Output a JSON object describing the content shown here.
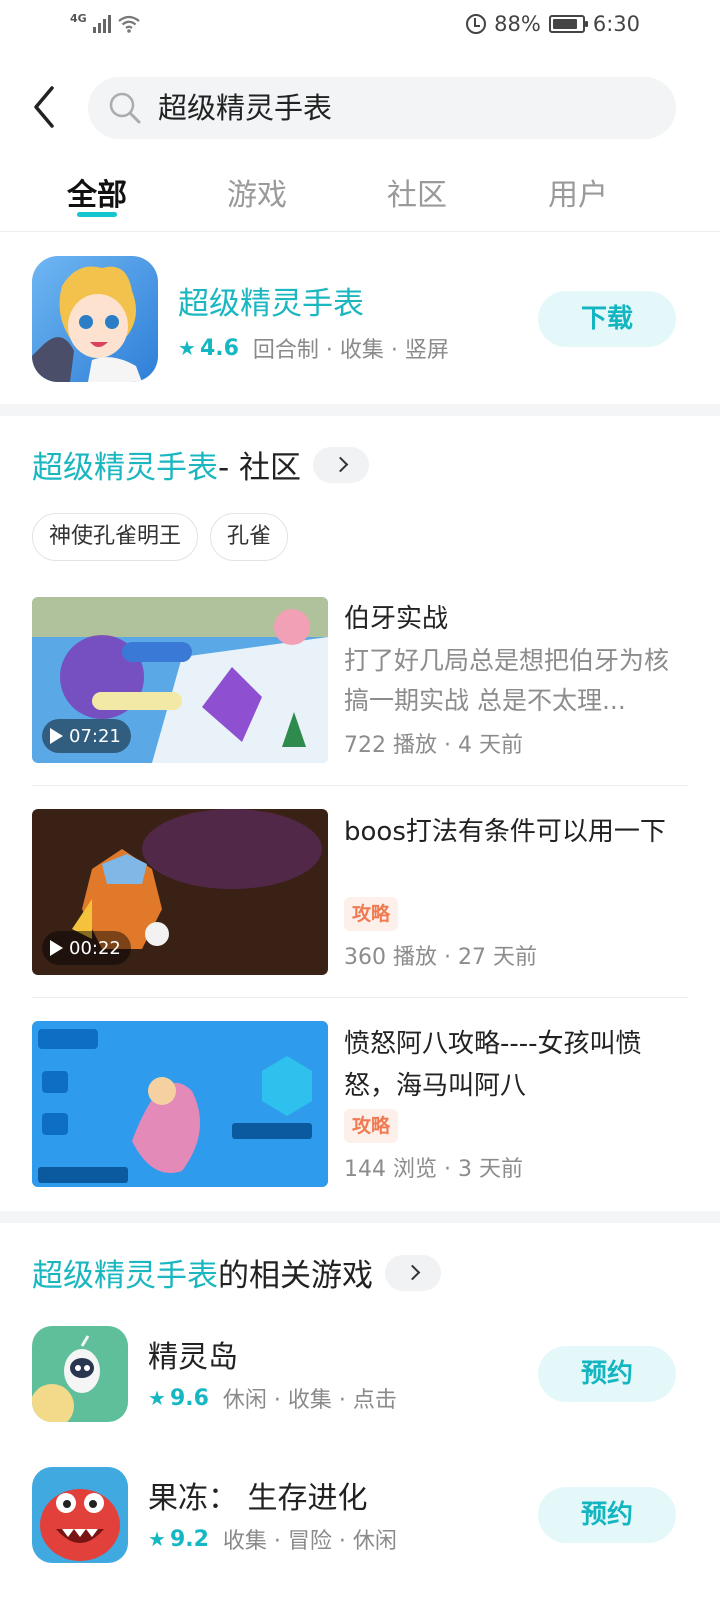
{
  "status_bar": {
    "network": "4G",
    "battery": "88%",
    "time": "6:30",
    "icons": [
      "signal-icon",
      "wifi-icon",
      "alarm-icon",
      "battery-icon"
    ]
  },
  "search": {
    "query": "超级精灵手表"
  },
  "tabs": [
    {
      "label": "全部",
      "active": true
    },
    {
      "label": "游戏",
      "active": false
    },
    {
      "label": "社区",
      "active": false
    },
    {
      "label": "用户",
      "active": false
    }
  ],
  "app": {
    "title": "超级精灵手表",
    "rating": "4.6",
    "tags": "回合制 · 收集 · 竖屏",
    "button": "下载"
  },
  "community": {
    "title_accent": "超级精灵手表",
    "title_rest": " - 社区",
    "chips": [
      "神使孔雀明王",
      "孔雀"
    ],
    "posts": [
      {
        "title": "伯牙实战",
        "desc": "打了好几局总是想把伯牙为核搞一期实战 总是不太理...",
        "duration": "07:21",
        "meta": "722 播放 · 4 天前"
      },
      {
        "title": "boos打法有条件可以用一下",
        "tag": "攻略",
        "duration": "00:22",
        "meta": "360 播放 · 27 天前"
      },
      {
        "title": "愤怒阿八攻略----女孩叫愤怒，海马叫阿八",
        "tag": "攻略",
        "meta": "144 浏览 · 3 天前"
      }
    ]
  },
  "related": {
    "title_accent": "超级精灵手表",
    "title_rest": "的相关游戏",
    "games": [
      {
        "title": "精灵岛",
        "rating": "9.6",
        "tags": "休闲 · 收集 · 点击",
        "button": "预约"
      },
      {
        "title": "果冻： 生存进化",
        "rating": "9.2",
        "tags": "收集 · 冒险 · 休闲",
        "button": "预约"
      }
    ]
  },
  "colors": {
    "accent": "#1ab7c1",
    "button_bg": "#e5f8f9",
    "tag_orange": "#f07b52"
  }
}
